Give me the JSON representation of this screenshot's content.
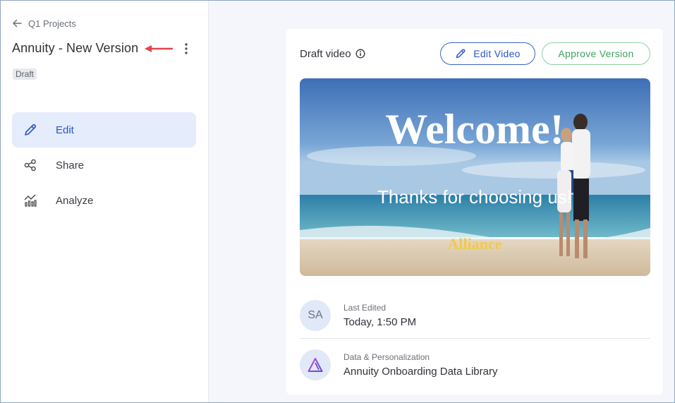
{
  "sidebar": {
    "back_label": "Q1 Projects",
    "title": "Annuity - New Version",
    "status": "Draft",
    "nav": [
      {
        "label": "Edit",
        "icon": "pencil-icon",
        "active": true
      },
      {
        "label": "Share",
        "icon": "share-icon",
        "active": false
      },
      {
        "label": "Analyze",
        "icon": "analytics-icon",
        "active": false
      }
    ]
  },
  "main": {
    "card": {
      "heading": "Draft video",
      "edit_button": "Edit Video",
      "approve_button": "Approve Version",
      "video": {
        "headline": "Welcome!",
        "subline": "Thanks for choosing us!",
        "brand": "Alliance"
      },
      "last_edited": {
        "avatar": "SA",
        "label": "Last Edited",
        "value": "Today, 1:50 PM"
      },
      "data_library": {
        "label": "Data & Personalization",
        "value": "Annuity Onboarding Data Library"
      }
    }
  },
  "colors": {
    "accent": "#2b56c4",
    "approve": "#3fa35f",
    "annotation_arrow": "#e0464a"
  }
}
